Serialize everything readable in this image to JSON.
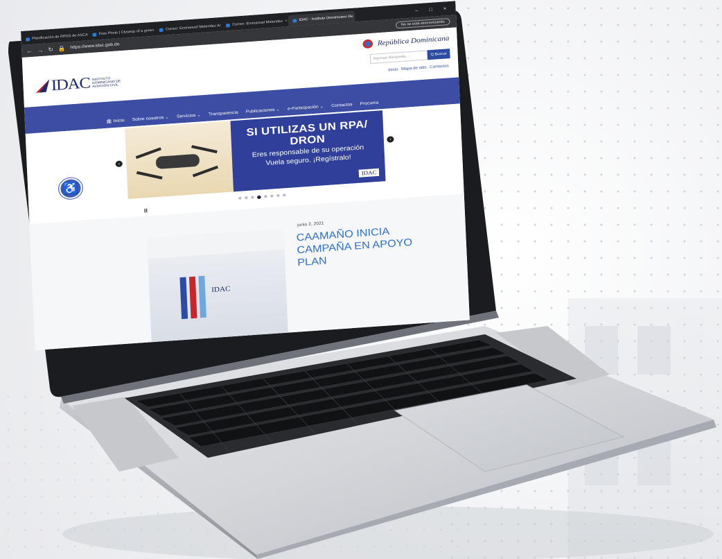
{
  "browser": {
    "tabs": [
      {
        "label": "Planificación de RRSS de ASCA",
        "active": false
      },
      {
        "label": "Free Photo | Closeup of a green",
        "active": false
      },
      {
        "label": "Correo: Emmanuel Melendez Ar",
        "active": false
      },
      {
        "label": "Correo: Emmanuel Melendez",
        "active": false
      },
      {
        "label": "IDAC - Instituto Dominicano De",
        "active": true
      }
    ],
    "window_controls": "– □ ×",
    "url": "https://www.idac.gob.do",
    "profile_label": "No se está sincronizando"
  },
  "site": {
    "logo_text": "IDAC",
    "logo_sub": "INSTITUTO DOMINICANO DE AVIACIÓN CIVIL",
    "republic": "República Dominicana",
    "search_placeholder": "Ingresar búsqueda...",
    "search_button": "Q Buscar",
    "top_links": [
      "Inicio",
      "Mapa de sitio",
      "Contactos"
    ],
    "menu": [
      {
        "label": "Inicio",
        "home": true
      },
      {
        "label": "Sobre nosotros ⌄"
      },
      {
        "label": "Servicios ⌄"
      },
      {
        "label": "Transparencia"
      },
      {
        "label": "Publicaciones ⌄"
      },
      {
        "label": "e-Participación ⌄"
      },
      {
        "label": "Contactos"
      },
      {
        "label": "Procuma"
      }
    ]
  },
  "banner": {
    "headline": "SI UTILIZAS UN RPA/ DRON",
    "line1": "Eres responsable de su operación",
    "line2": "Vuela seguro. ¡Regístralo!",
    "logo": "IDAC",
    "dots_total": 8,
    "active_dot": 4,
    "pause": "II"
  },
  "news": {
    "date": "junio 2, 2021",
    "title": "CAAMAÑO INICIA CAMPAÑA EN APOYO PLAN",
    "photo_logo": "IDAC"
  }
}
